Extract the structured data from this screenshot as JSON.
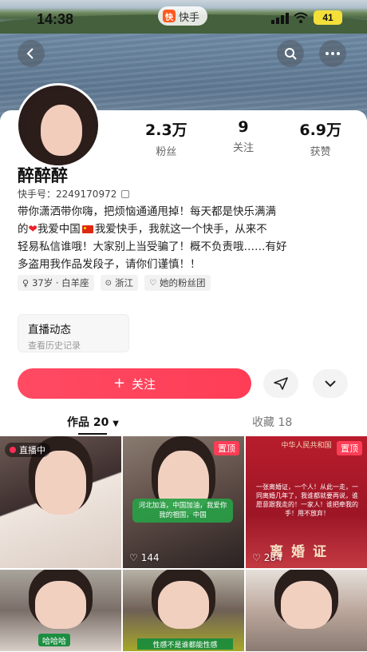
{
  "status_bar": {
    "time": "14:38",
    "app_name": "快手",
    "battery": "41"
  },
  "profile": {
    "nickname": "醉醉醉",
    "uid_label": "快手号：2249170972",
    "bio_line1": "带你潇洒带你嗨，把烦恼通通甩掉！每天都是快乐满满",
    "bio_line2a": "的",
    "bio_line2b": "我爱中国",
    "bio_line2c": "我爱快手，我就这一个快手，从来不",
    "bio_line3": "轻易私信谁哦！大家别上当受骗了！概不负责哦……有好",
    "bio_line4": "多盗用我作品发段子，请你们谨慎！！",
    "tags": [
      "37岁 · 白羊座",
      "浙江",
      "她的粉丝团"
    ]
  },
  "stats": [
    {
      "num": "2.3万",
      "label": "粉丝"
    },
    {
      "num": "9",
      "label": "关注"
    },
    {
      "num": "6.9万",
      "label": "获赞"
    }
  ],
  "live_box": {
    "title": "直播动态",
    "subtitle": "查看历史记录"
  },
  "actions": {
    "follow": "关注"
  },
  "tabs": {
    "works": "作品 20",
    "collect": "收藏 18"
  },
  "grid": {
    "live_tag": "直播中",
    "pin": "置顶",
    "likes_b": "144",
    "likes_c": "284",
    "caption_b": "河北加油，中国加油，我爱你我的祖国，中国",
    "cert_top": "中华人民共和国",
    "cert_para": "一张离婚证，一个人！从此一走，一同离婚几年了，我谁都就要再说，谁愿意跟我走的！一家人！谁把牵我的手！用不放弃！",
    "cert_big": "离婚证",
    "caption_d": "哈哈哈",
    "caption_e": "性感不是谁都能性感"
  },
  "colors": {
    "follow": "#ff4a63",
    "pin": "#ff3d56",
    "battery": "#f4df3a"
  }
}
